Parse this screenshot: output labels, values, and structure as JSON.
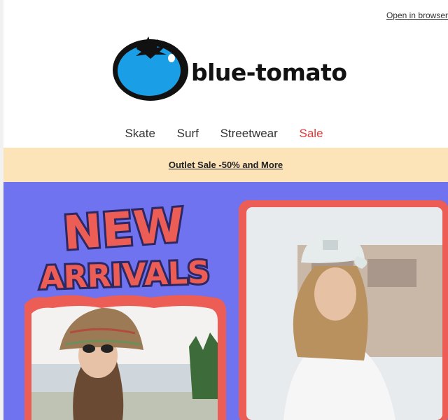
{
  "header": {
    "open_in_browser": "Open in browser",
    "brand_name": "blue-tomato"
  },
  "nav": [
    {
      "label": "Skate"
    },
    {
      "label": "Surf"
    },
    {
      "label": "Streetwear"
    },
    {
      "label": "Sale"
    }
  ],
  "promo_banner": {
    "label": "Outlet Sale -50% and More"
  },
  "hero": {
    "headline_art": "NEW ARRIVALS"
  },
  "colors": {
    "hero_bg": "#6f73ef",
    "frame_red": "#ec5d55",
    "banner_bg": "#fde3b8",
    "sale_red": "#e03b3b",
    "logo_blue": "#1a9ee5"
  }
}
